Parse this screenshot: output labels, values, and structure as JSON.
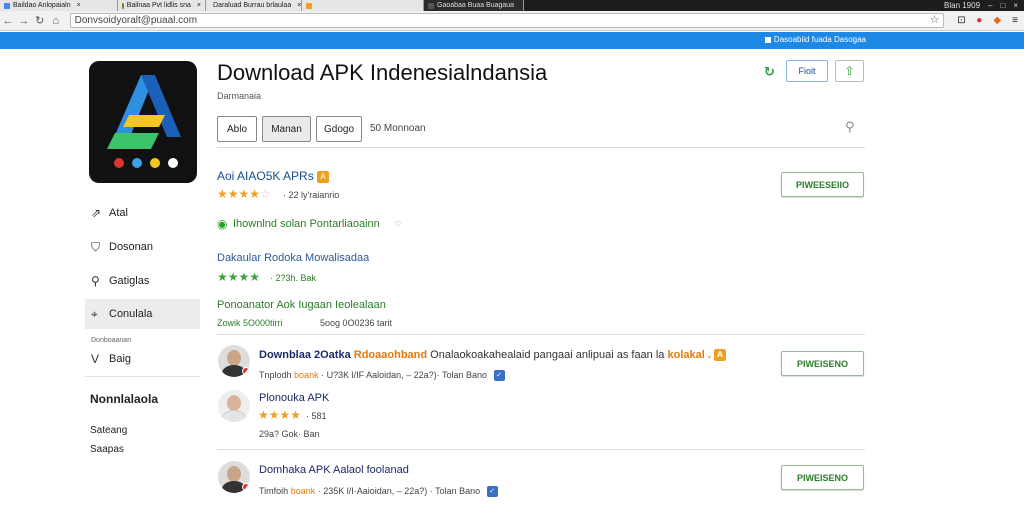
{
  "browser": {
    "tabs": [
      {
        "title": "Baildao Anlopaialn",
        "color": "#4285f4",
        "dark": false
      },
      {
        "title": "Bailnaa Pvt lidlis sna",
        "color": "#6b8e23",
        "dark": false
      },
      {
        "title": "Daraluad Burrau brlaulaa",
        "color": "#2e7d32",
        "dark": false
      },
      {
        "title": "",
        "color": "#f0a020",
        "dark": false
      },
      {
        "title": "Gaoabaa Buaa Buagaua",
        "color": "#555555",
        "dark": true
      }
    ],
    "window_label": "Blan 1909",
    "url": "Donvsoidyoralt@puaal.com"
  },
  "banner": {
    "text": "Dasoabiid fuada Dasogaa"
  },
  "sidebar": {
    "items": [
      {
        "icon": "share-icon",
        "glyph": "⇗",
        "label": "Atal"
      },
      {
        "icon": "shield-icon",
        "glyph": "⛉",
        "label": "Dosonan"
      },
      {
        "icon": "pin-icon",
        "glyph": "⚲",
        "label": "Gatiglas"
      },
      {
        "icon": "tag-icon",
        "glyph": "⌖",
        "label": "Conulala"
      }
    ],
    "small_label": "Donboaanan",
    "extra_item": {
      "glyph": "V",
      "label": "Baig"
    },
    "section_head": "Nonnlalaola",
    "links": [
      "Sateang",
      "Saapas"
    ]
  },
  "app": {
    "title": "Download APK Indenesialndansia",
    "developer": "Darmanaia",
    "header_btn": "Fioit",
    "filters": [
      "Ablo",
      "Manan",
      "Gdogo"
    ],
    "filter_count": "50 Monnoan"
  },
  "listings": {
    "first": {
      "title": "Aoi AIAO5K APRs",
      "badge": "A",
      "rating_meta": "· 22 ly'raianrio",
      "download_label": "PIWEESEIIO"
    },
    "promo": "Ihownlnd solan Pontarliaoainn",
    "second": {
      "title": "Dakaular Rodoka Mowalisadaa",
      "meta": "· 2?3h. Bak"
    },
    "third": {
      "title": "Ponoanator Aok Iugaan Ieolealaan",
      "meta_left": "Zowik 5O000tirri",
      "meta_right": "5oog 0O0236 tarit"
    },
    "row1": {
      "title_a": "Downblaa 2Oatka",
      "title_b": "Rdoaaohband",
      "title_c": "Onalaokoakahealaid pangaai anlipuai as faan la",
      "title_d": "kolakal .",
      "badge": "A",
      "meta_a": "Tnplodh",
      "meta_b": "boank",
      "meta_c": "· U?3K  l/IF  Aaloidan,  – 22a?)·  Tolan  Bano",
      "download_label": "PIWEISENO"
    },
    "row2": {
      "title": "Plonouka APK",
      "rating_meta": "· 581",
      "meta": "29a?  Gok·  Ban"
    },
    "row3": {
      "title": "Domhaka APK   Aalaol foolanad",
      "meta_a": "Timfoih",
      "meta_b": "boank",
      "meta_c": "·  235K l/I·Aaioidan, – 22a?) · Tolan  Bano",
      "download_label": "PIWEISENO"
    }
  },
  "colors": {
    "accent": "#1e88e5",
    "link": "#1a4d8f",
    "green": "#2a7d2a",
    "star": "#f0a020"
  }
}
